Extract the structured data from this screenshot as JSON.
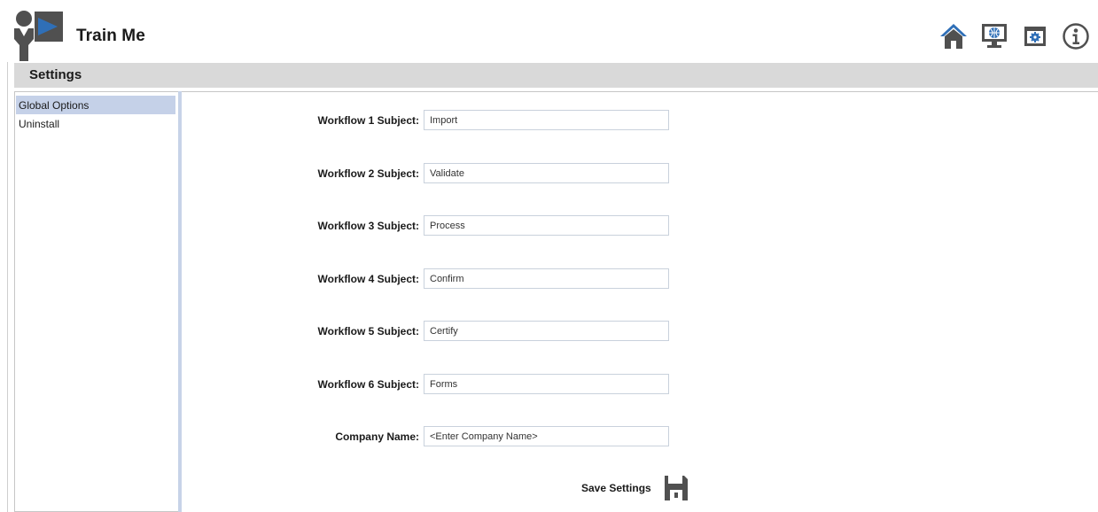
{
  "app": {
    "title": "Train Me"
  },
  "header": {
    "icons": [
      "home-icon",
      "web-monitor-icon",
      "settings-window-icon",
      "info-icon"
    ]
  },
  "section": {
    "title": "Settings"
  },
  "sidebar": {
    "items": [
      {
        "label": "Global Options",
        "active": true
      },
      {
        "label": "Uninstall",
        "active": false
      }
    ]
  },
  "form": {
    "fields": [
      {
        "label": "Workflow 1 Subject:",
        "value": "Import"
      },
      {
        "label": "Workflow 2 Subject:",
        "value": "Validate"
      },
      {
        "label": "Workflow 3 Subject:",
        "value": "Process"
      },
      {
        "label": "Workflow 4 Subject:",
        "value": "Confirm"
      },
      {
        "label": "Workflow 5 Subject:",
        "value": "Certify"
      },
      {
        "label": "Workflow 6 Subject:",
        "value": "Forms"
      },
      {
        "label": "Company Name:",
        "value": "<Enter Company Name>"
      }
    ],
    "save_label": "Save Settings"
  },
  "colors": {
    "accent_blue": "#2f6fb7",
    "icon_gray": "#505050",
    "section_bar": "#d9d9d9",
    "sidebar_active": "#c5d1e8"
  }
}
